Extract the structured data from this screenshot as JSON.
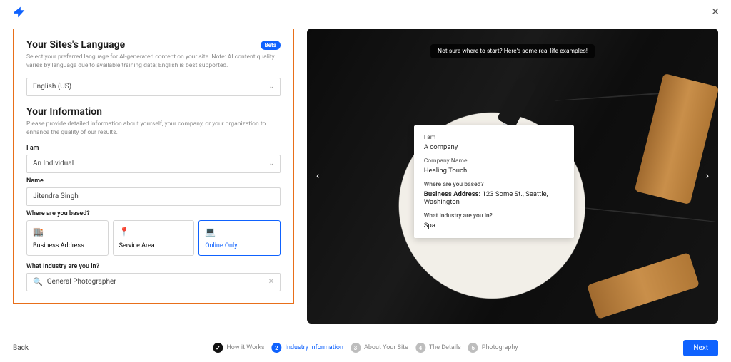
{
  "header": {
    "close_title": "Close"
  },
  "left": {
    "lang": {
      "title": "Your Sites's Language",
      "badge": "Beta",
      "help": "Select your preferred language for AI-generated content on your site. Note: AI content quality varies by language due to available training data; English is best supported.",
      "selected": "English (US)"
    },
    "info": {
      "title": "Your Information",
      "help": "Please provide detailed information about yourself, your company, or your organization to enhance the quality of our results.",
      "iam_label": "I am",
      "iam_value": "An Individual",
      "name_label": "Name",
      "name_value": "Jitendra Singh",
      "based_label": "Where are you based?",
      "options": [
        {
          "label": "Business Address"
        },
        {
          "label": "Service Area"
        },
        {
          "label": "Online Only"
        }
      ],
      "industry_label": "What Industry are you in?",
      "industry_value": "General Photographer"
    }
  },
  "preview": {
    "tooltip": "Not sure where to start? Here's some real life examples!",
    "card": {
      "iam_label": "I am",
      "iam_value": "A company",
      "company_label": "Company Name",
      "company_value": "Healing Touch",
      "based_label": "Where are you based?",
      "address_label": "Business Address:",
      "address_value": " 123 Some St., Seattle, Washington",
      "industry_label": "What industry are you in?",
      "industry_value": "Spa"
    }
  },
  "footer": {
    "back": "Back",
    "next": "Next",
    "steps": [
      {
        "num": "✓",
        "label": "How it Works"
      },
      {
        "num": "2",
        "label": "Industry Information"
      },
      {
        "num": "3",
        "label": "About Your Site"
      },
      {
        "num": "4",
        "label": "The Details"
      },
      {
        "num": "5",
        "label": "Photography"
      }
    ]
  }
}
